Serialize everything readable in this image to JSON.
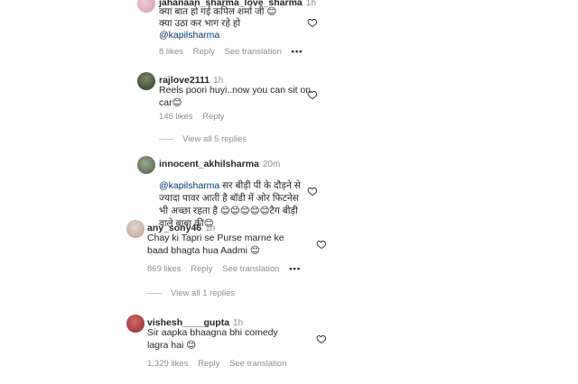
{
  "comments": [
    {
      "username": "jahanaan_sharma_love_sharma",
      "time": "1h",
      "lines": [
        "क्या बात हो गई कपिल शर्मा जी 😊",
        "क्या उठा कर भाग रहे हो"
      ],
      "mention": "@kapilsharma",
      "likes": "8 likes",
      "reply": "Reply",
      "see_translation": "See translation",
      "more": "•••"
    },
    {
      "username": "rajlove2111",
      "time": "1h",
      "text": "Reels poori huyi..now you can sit on\ncar😊",
      "likes": "146 likes",
      "reply": "Reply",
      "view_replies": "View all 5 replies"
    },
    {
      "username": "innocent_akhilsharma",
      "time": "20m",
      "mention": "@kapilsharma",
      "text_after_mention": " सर बीड़ी पी के दौड़ने से\nज्यादा पावर आती है बॉडी में ओर फिटनेस\nभी अच्छा रहता है 😊😊😊😊😊टैग बीड़ी\nवाले बाबा की😊"
    },
    {
      "username": "any_sony46",
      "time": "1h",
      "text": "Chay ki Tapri se Purse marne ke\nbaad bhagta hua Aadmi 😊",
      "likes": "869 likes",
      "reply": "Reply",
      "see_translation": "See translation",
      "more": "•••",
      "view_replies": "View all 1 replies"
    },
    {
      "username": "vishesh____gupta",
      "time": "1h",
      "text": "Sir aapka bhaagna bhi comedy\nlagra hai 😊",
      "likes": "1,329 likes",
      "reply": "Reply",
      "see_translation": "See translation"
    }
  ]
}
